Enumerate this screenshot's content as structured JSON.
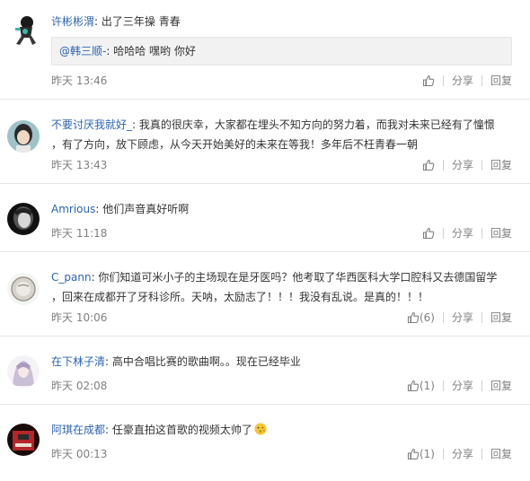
{
  "comments": [
    {
      "username": "许彬彬渭",
      "colon": ":",
      "text": " 出了三年操 青春",
      "reply": {
        "mention": "@韩三顺-",
        "text": ": 哈哈哈 嘿哟 你好"
      },
      "time": "昨天 13:46",
      "like_count": "",
      "share": "分享",
      "reply_label": "回复"
    },
    {
      "username": "不要讨厌我就好_",
      "colon": ":",
      "text": " 我真的很庆幸，大家都在埋头不知方向的努力着，而我对未来已经有了憧憬",
      "text2": "，有了方向，放下顾虑，从今天开始美好的未来在等我！多年后不枉青春一朝",
      "time": "昨天 13:43",
      "like_count": "",
      "share": "分享",
      "reply_label": "回复"
    },
    {
      "username": "Amrious",
      "colon": ":",
      "text": " 他们声音真好听啊",
      "time": "昨天 11:18",
      "like_count": "",
      "share": "分享",
      "reply_label": "回复"
    },
    {
      "username": "C_pann",
      "colon": ":",
      "text": " 你们知道可米小子的主场现在是牙医吗？他考取了华西医科大学口腔科又去德国留学",
      "text2": "，回来在成都开了牙科诊所。天呐，太励志了！！！我没有乱说。是真的！！！",
      "time": "昨天 10:06",
      "like_count": "(6)",
      "share": "分享",
      "reply_label": "回复"
    },
    {
      "username": "在下林子清",
      "colon": ":",
      "text": " 高中合唱比赛的歌曲啊。。现在已经毕业",
      "time": "昨天 02:08",
      "like_count": "(1)",
      "share": "分享",
      "reply_label": "回复"
    },
    {
      "username": "阿琪在成都",
      "colon": ":",
      "text": " 任豪直拍这首歌的视频太帅了",
      "emoji": "kiss-face-icon",
      "time": "昨天 00:13",
      "like_count": "(1)",
      "share": "分享",
      "reply_label": "回复"
    }
  ],
  "colors": {
    "link": "#2d64b3",
    "meta": "#808080",
    "text": "#333333",
    "divider": "#e6e6e6"
  }
}
